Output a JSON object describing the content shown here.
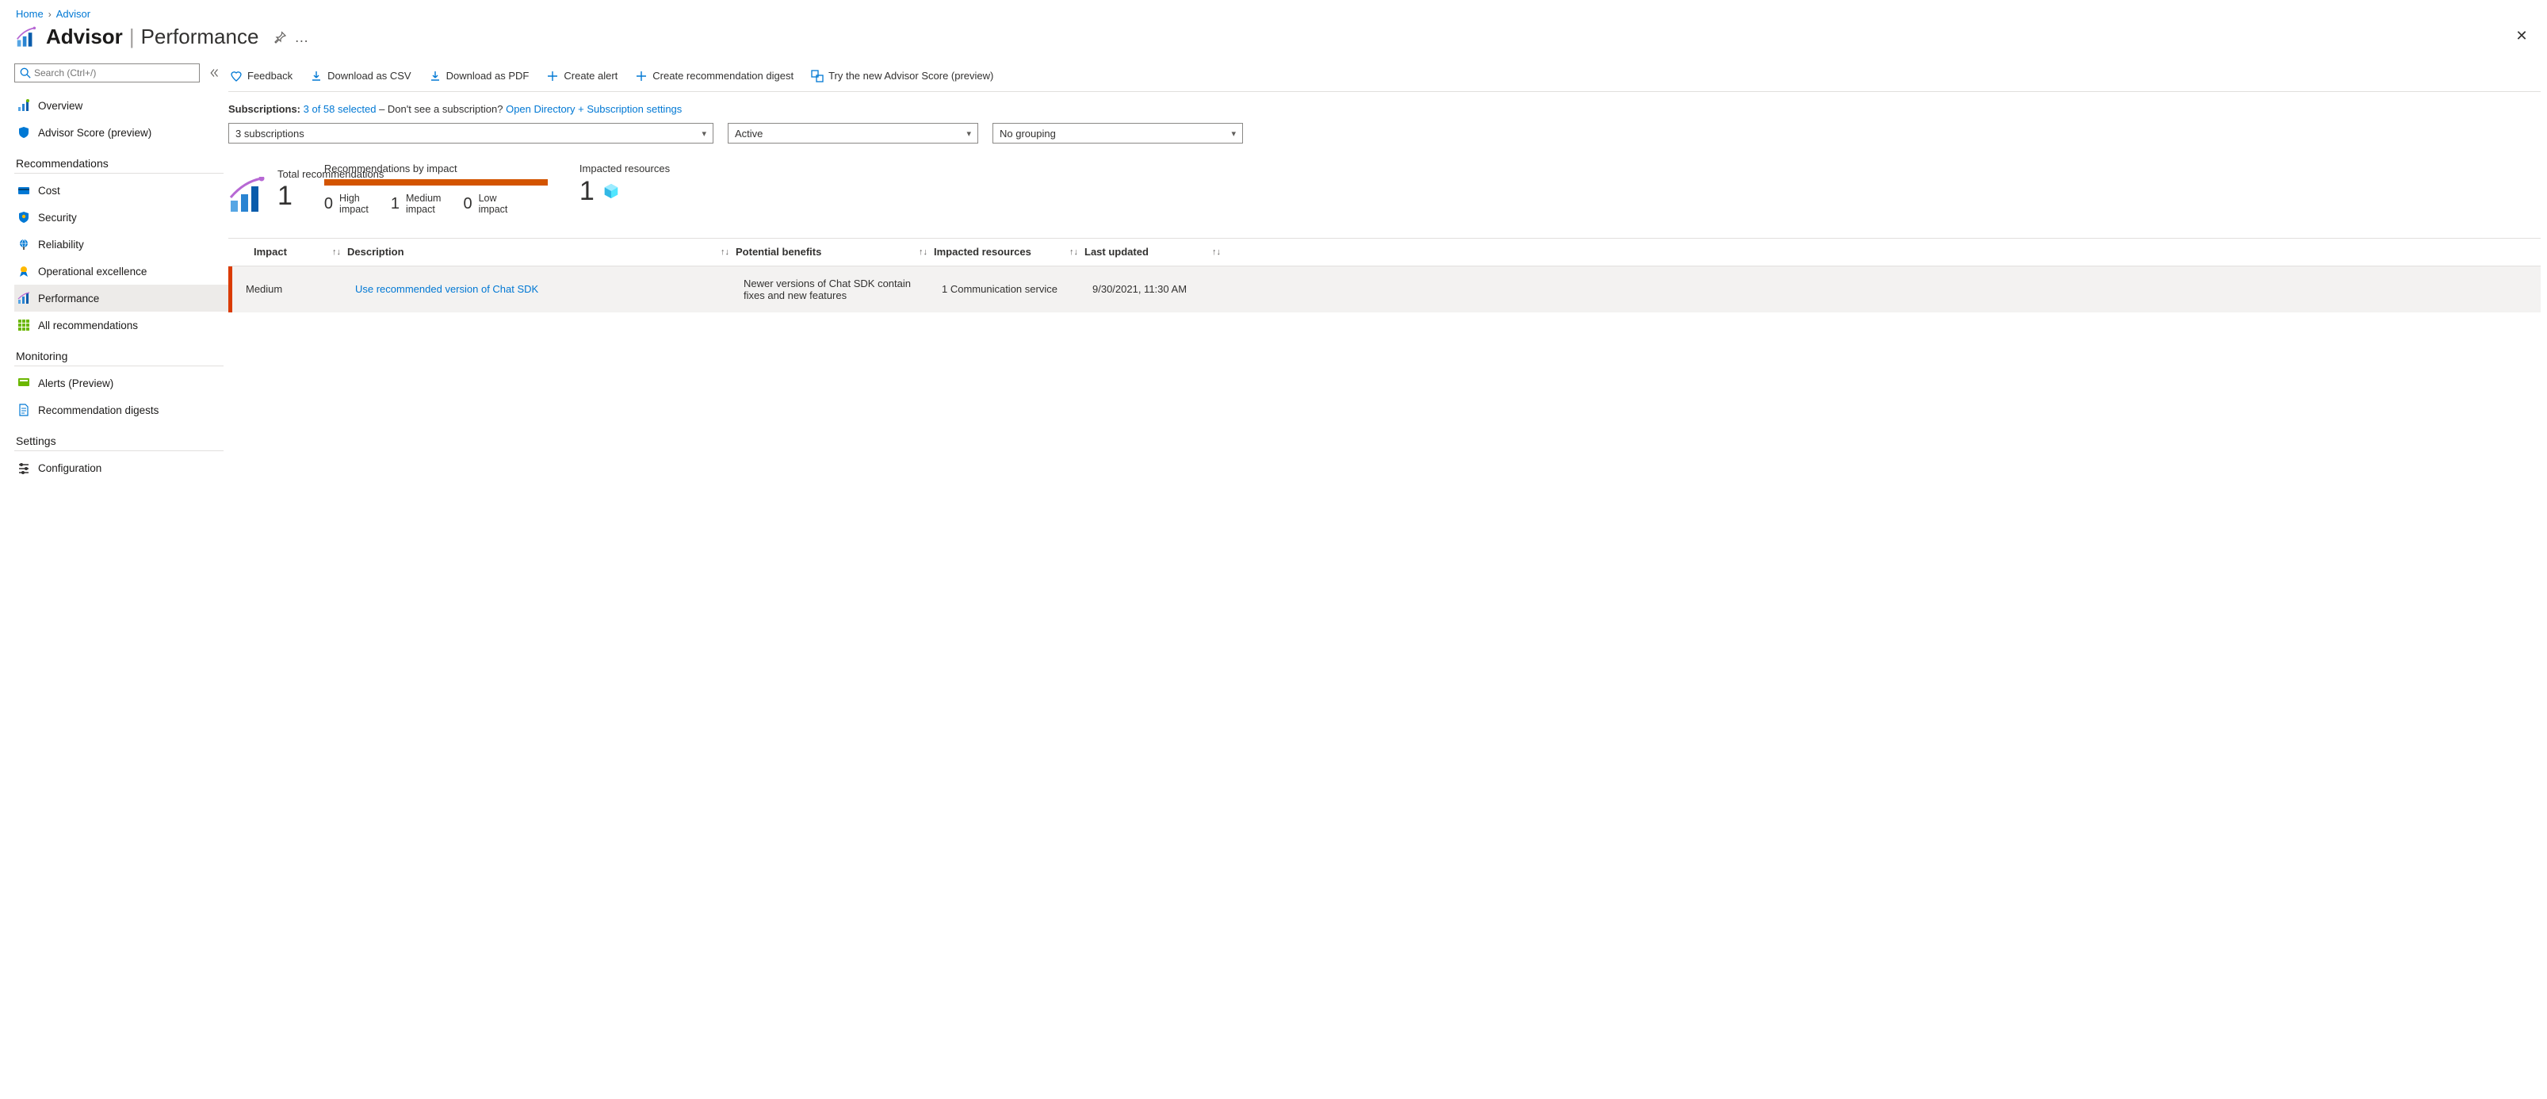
{
  "breadcrumb": {
    "home": "Home",
    "advisor": "Advisor"
  },
  "title": {
    "main": "Advisor",
    "sub": "Performance"
  },
  "search": {
    "placeholder": "Search (Ctrl+/)"
  },
  "sidebar": {
    "overview": "Overview",
    "score": "Advisor Score (preview)",
    "sec_recs": "Recommendations",
    "cost": "Cost",
    "security": "Security",
    "reliability": "Reliability",
    "opex": "Operational excellence",
    "performance": "Performance",
    "allrecs": "All recommendations",
    "sec_mon": "Monitoring",
    "alerts": "Alerts (Preview)",
    "digests": "Recommendation digests",
    "sec_set": "Settings",
    "config": "Configuration"
  },
  "toolbar": {
    "feedback": "Feedback",
    "csv": "Download as CSV",
    "pdf": "Download as PDF",
    "alert": "Create alert",
    "digest": "Create recommendation digest",
    "score": "Try the new Advisor Score (preview)"
  },
  "filterbar": {
    "subs_label": "Subscriptions:",
    "subs_link": "3 of 58 selected",
    "subs_note": " – Don't see a subscription? ",
    "subs_open": "Open Directory + Subscription settings",
    "sel1": "3 subscriptions",
    "sel2": "Active",
    "sel3": "No grouping"
  },
  "summary": {
    "tot_label": "Total recommendations",
    "tot_value": "1",
    "impact_label": "Recommendations by impact",
    "high_n": "0",
    "high_t1": "High",
    "high_t2": "impact",
    "med_n": "1",
    "med_t1": "Medium",
    "med_t2": "impact",
    "low_n": "0",
    "low_t1": "Low",
    "low_t2": "impact",
    "impres_label": "Impacted resources",
    "impres_value": "1"
  },
  "table": {
    "h_impact": "Impact",
    "h_desc": "Description",
    "h_benefit": "Potential benefits",
    "h_impres": "Impacted resources",
    "h_updated": "Last updated",
    "rows": [
      {
        "impact": "Medium",
        "desc": "Use recommended version of Chat SDK",
        "benefit": "Newer versions of Chat SDK contain fixes and new features",
        "impres": "1 Communication service",
        "updated": "9/30/2021, 11:30 AM"
      }
    ]
  }
}
